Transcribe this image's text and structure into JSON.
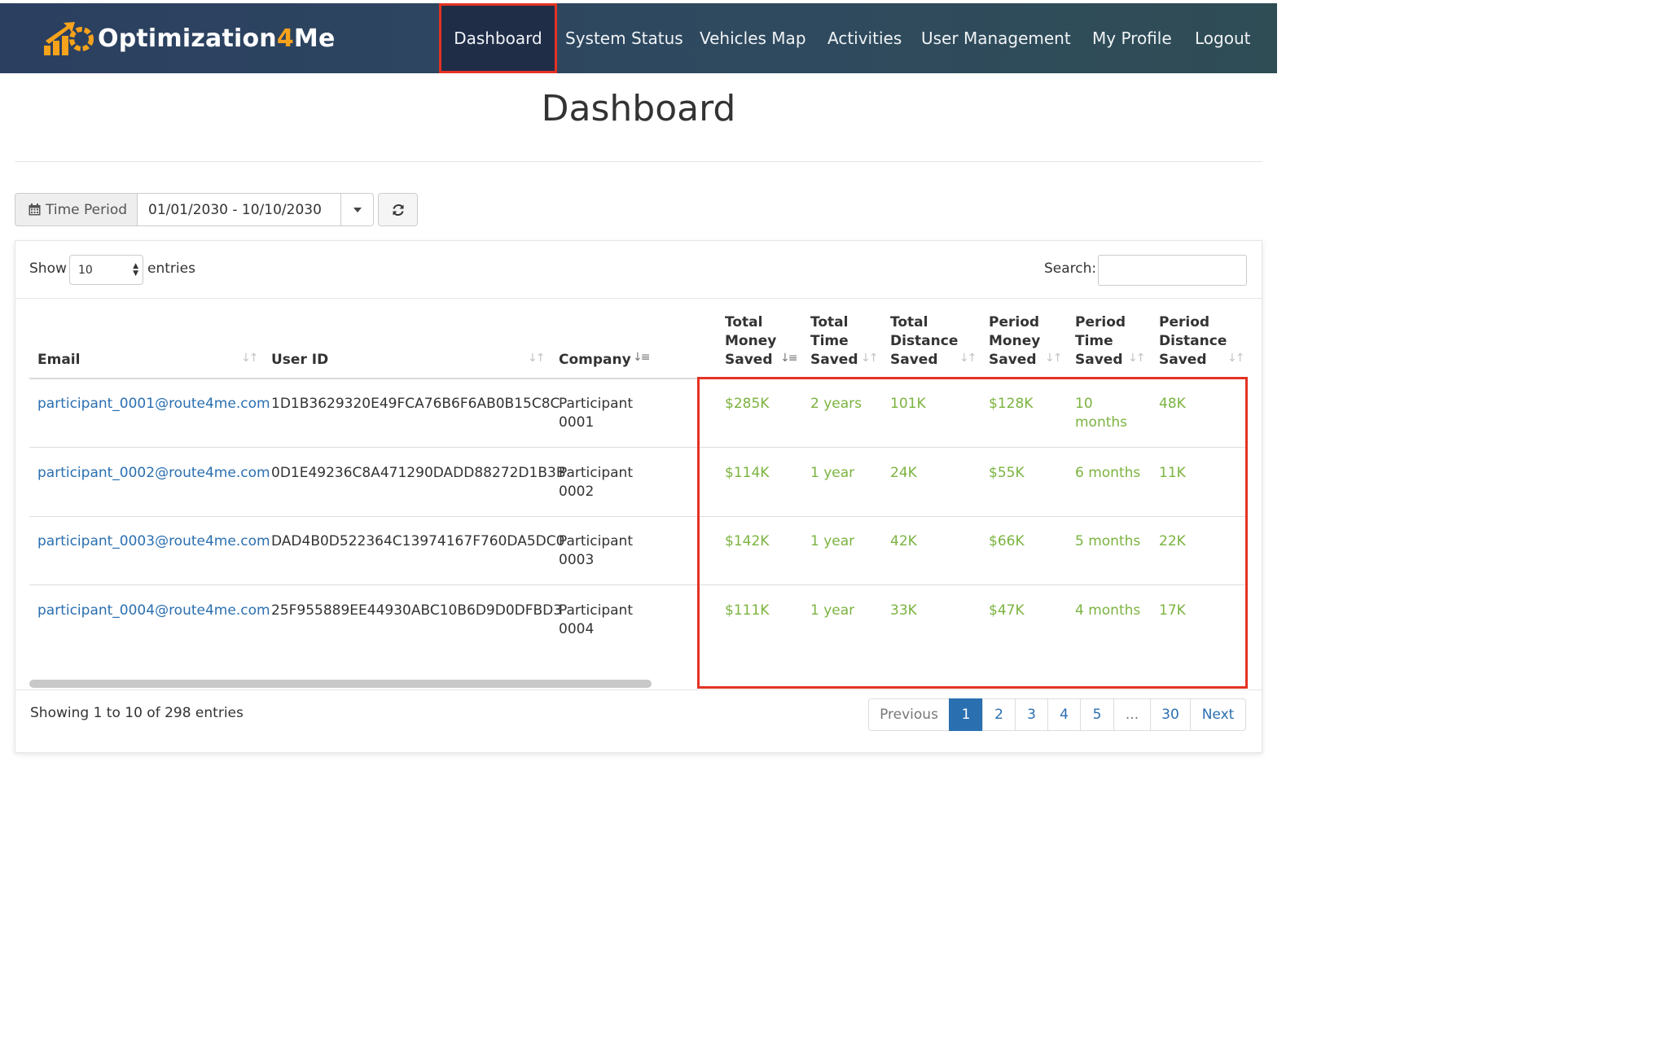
{
  "brand": {
    "name_part1": "Optimization",
    "name_part2": "4",
    "name_part3": "Me"
  },
  "nav": {
    "items": [
      {
        "label": "Dashboard",
        "active": true
      },
      {
        "label": "System Status"
      },
      {
        "label": "Vehicles Map"
      },
      {
        "label": "Activities"
      },
      {
        "label": "User Management"
      },
      {
        "label": "My Profile"
      },
      {
        "label": "Logout"
      }
    ]
  },
  "page": {
    "title": "Dashboard"
  },
  "time_period": {
    "label": "Time Period",
    "value": "01/01/2030 - 10/10/2030"
  },
  "table_controls": {
    "show_label": "Show",
    "length_value": "10",
    "entries_label": "entries",
    "search_label": "Search:",
    "search_value": ""
  },
  "table": {
    "headers": {
      "email": "Email",
      "user_id": "User ID",
      "company": "Company",
      "total_money": [
        "Total",
        "Money",
        "Saved"
      ],
      "total_time": [
        "Total",
        "Time",
        "Saved"
      ],
      "total_distance": [
        "Total",
        "Distance",
        "Saved"
      ],
      "period_money": [
        "Period",
        "Money",
        "Saved"
      ],
      "period_time": [
        "Period",
        "Time",
        "Saved"
      ],
      "period_distance": [
        "Period",
        "Distance",
        "Saved"
      ]
    },
    "rows": [
      {
        "email": "participant_0001@route4me.com",
        "user_id": "1D1B3629320E49FCA76B6F6AB0B15C8C",
        "company": [
          "Participant",
          "0001"
        ],
        "total_money": "$285K",
        "total_time": "2 years",
        "total_distance": "101K",
        "period_money": "$128K",
        "period_time": [
          "10",
          "months"
        ],
        "period_distance": "48K"
      },
      {
        "email": "participant_0002@route4me.com",
        "user_id": "0D1E49236C8A471290DADD88272D1B3B",
        "company": [
          "Participant",
          "0002"
        ],
        "total_money": "$114K",
        "total_time": "1 year",
        "total_distance": "24K",
        "period_money": "$55K",
        "period_time": [
          "6 months"
        ],
        "period_distance": "11K"
      },
      {
        "email": "participant_0003@route4me.com",
        "user_id": "DAD4B0D522364C13974167F760DA5DC0",
        "company": [
          "Participant",
          "0003"
        ],
        "total_money": "$142K",
        "total_time": "1 year",
        "total_distance": "42K",
        "period_money": "$66K",
        "period_time": [
          "5 months"
        ],
        "period_distance": "22K"
      },
      {
        "email": "participant_0004@route4me.com",
        "user_id": "25F955889EE44930ABC10B6D9D0DFBD3",
        "company": [
          "Participant",
          "0004"
        ],
        "total_money": "$111K",
        "total_time": "1 year",
        "total_distance": "33K",
        "period_money": "$47K",
        "period_time": [
          "4 months"
        ],
        "period_distance": "17K"
      }
    ]
  },
  "footer": {
    "info": "Showing 1 to 10 of 298 entries"
  },
  "pagination": {
    "previous": "Previous",
    "pages": [
      "1",
      "2",
      "3",
      "4",
      "5",
      "...",
      "30"
    ],
    "current_page": "1",
    "next": "Next"
  },
  "colors": {
    "nav_bg": "#2b3f60",
    "highlight": "#e53224",
    "link": "#2a6fb0",
    "value_green": "#7bb33f",
    "brand_orange": "#f6a21b"
  }
}
